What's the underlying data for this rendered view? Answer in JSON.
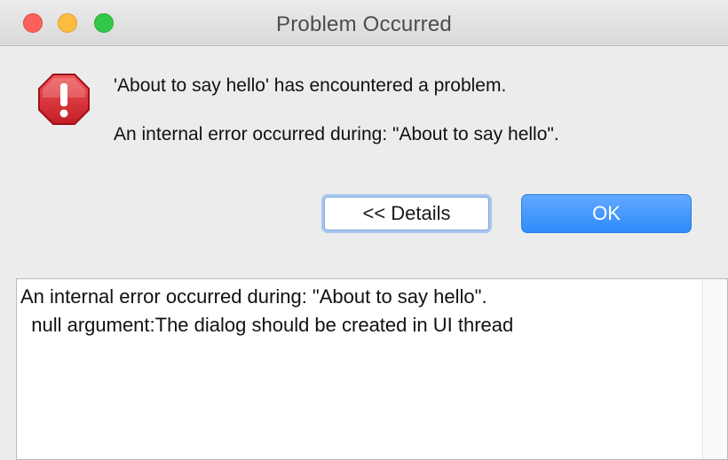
{
  "window": {
    "title": "Problem Occurred"
  },
  "dialog": {
    "icon": "error-stop-icon",
    "headline": "'About to say hello' has encountered a problem.",
    "detail": "An internal error occurred during: \"About to say hello\".",
    "buttons": {
      "details_label": "<< Details",
      "ok_label": "OK"
    }
  },
  "details": {
    "lines": [
      "An internal error occurred during: \"About to say hello\".",
      "  null argument:The dialog should be created in UI thread"
    ]
  },
  "colors": {
    "accent_blue": "#2d8cf9",
    "error_red": "#d4252d",
    "close_red": "#fc605b",
    "minimize_yellow": "#fdbc40",
    "maximize_green": "#34c84a"
  }
}
